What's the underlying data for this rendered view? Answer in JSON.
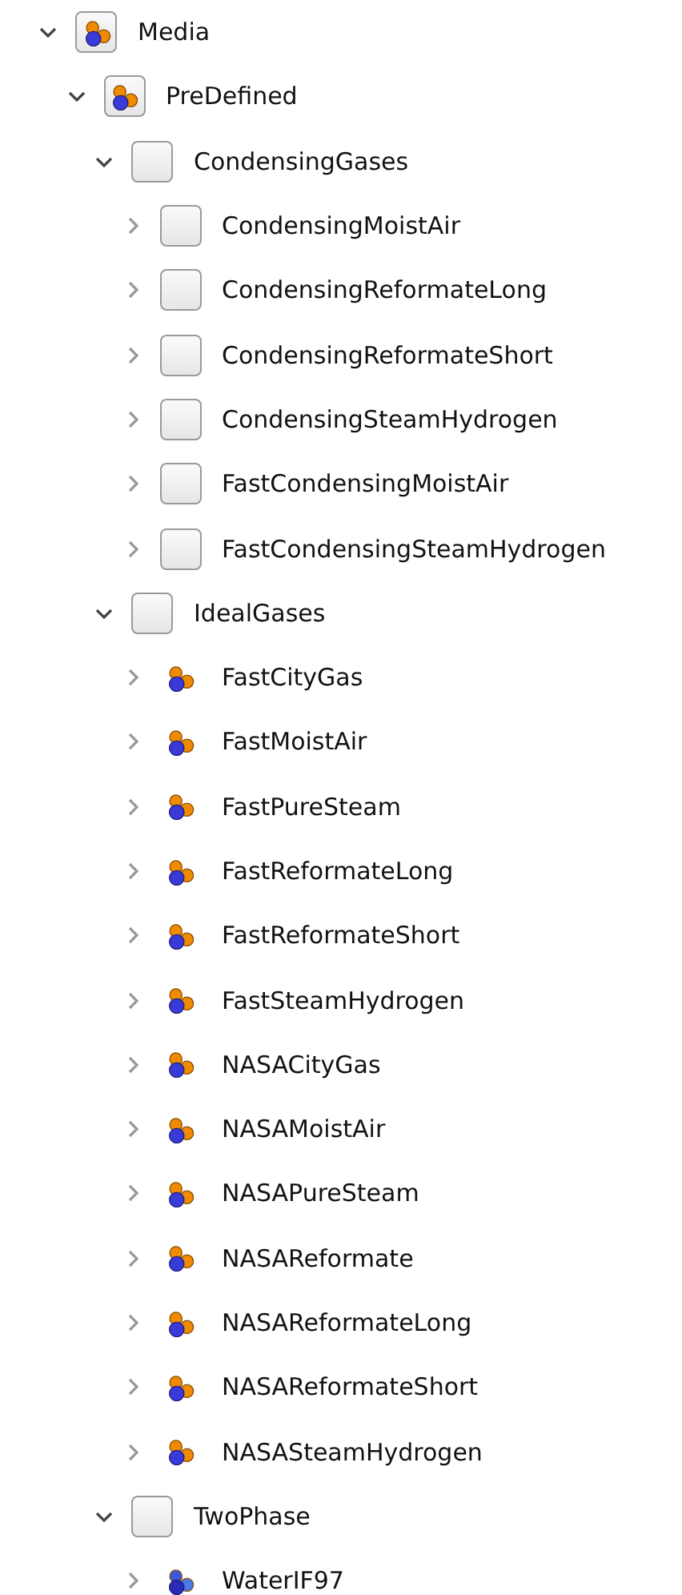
{
  "tree": [
    {
      "label": "Media",
      "kind": "package",
      "expanded": true,
      "children": [
        {
          "label": "PreDefined",
          "kind": "package",
          "expanded": true,
          "children": [
            {
              "label": "CondensingGases",
              "kind": "box",
              "expanded": true,
              "children": [
                {
                  "label": "CondensingMoistAir",
                  "kind": "box",
                  "expanded": false
                },
                {
                  "label": "CondensingReformateLong",
                  "kind": "box",
                  "expanded": false
                },
                {
                  "label": "CondensingReformateShort",
                  "kind": "box",
                  "expanded": false
                },
                {
                  "label": "CondensingSteamHydrogen",
                  "kind": "box",
                  "expanded": false
                },
                {
                  "label": "FastCondensingMoistAir",
                  "kind": "box",
                  "expanded": false
                },
                {
                  "label": "FastCondensingSteamHydrogen",
                  "kind": "box",
                  "expanded": false
                }
              ]
            },
            {
              "label": "IdealGases",
              "kind": "box",
              "expanded": true,
              "children": [
                {
                  "label": "FastCityGas",
                  "kind": "medium",
                  "expanded": false
                },
                {
                  "label": "FastMoistAir",
                  "kind": "medium",
                  "expanded": false
                },
                {
                  "label": "FastPureSteam",
                  "kind": "medium",
                  "expanded": false
                },
                {
                  "label": "FastReformateLong",
                  "kind": "medium",
                  "expanded": false
                },
                {
                  "label": "FastReformateShort",
                  "kind": "medium",
                  "expanded": false
                },
                {
                  "label": "FastSteamHydrogen",
                  "kind": "medium",
                  "expanded": false
                },
                {
                  "label": "NASACityGas",
                  "kind": "medium",
                  "expanded": false
                },
                {
                  "label": "NASAMoistAir",
                  "kind": "medium",
                  "expanded": false
                },
                {
                  "label": "NASAPureSteam",
                  "kind": "medium",
                  "expanded": false
                },
                {
                  "label": "NASAReformate",
                  "kind": "medium",
                  "expanded": false
                },
                {
                  "label": "NASAReformateLong",
                  "kind": "medium",
                  "expanded": false
                },
                {
                  "label": "NASAReformateShort",
                  "kind": "medium",
                  "expanded": false
                },
                {
                  "label": "NASASteamHydrogen",
                  "kind": "medium",
                  "expanded": false
                }
              ]
            },
            {
              "label": "TwoPhase",
              "kind": "box",
              "expanded": true,
              "children": [
                {
                  "label": "WaterIF97",
                  "kind": "water",
                  "expanded": false
                }
              ]
            }
          ]
        }
      ]
    }
  ]
}
